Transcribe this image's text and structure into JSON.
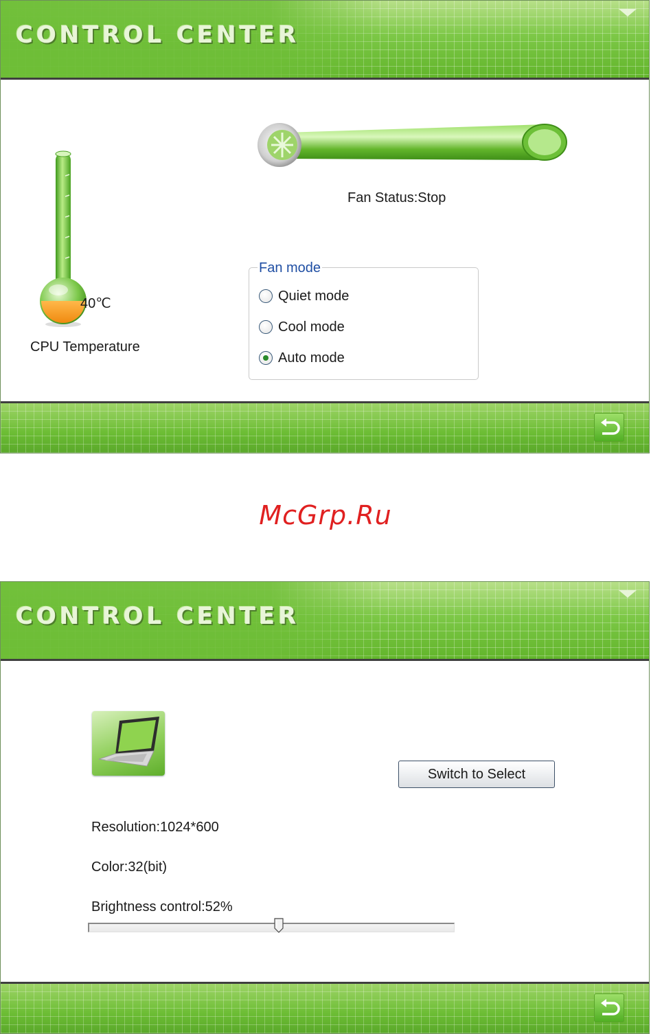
{
  "windows": [
    {
      "title": "CONTROL CENTER",
      "cpu": {
        "temperature_value": "40℃",
        "label": "CPU Temperature"
      },
      "fan": {
        "status": "Fan Status:Stop",
        "mode_legend": "Fan mode",
        "modes": [
          {
            "label": "Quiet mode",
            "selected": false
          },
          {
            "label": "Cool mode",
            "selected": false
          },
          {
            "label": "Auto mode",
            "selected": true
          }
        ]
      }
    },
    {
      "title": "CONTROL CENTER",
      "display": {
        "switch_button": "Switch to Select",
        "resolution": "Resolution:1024*600",
        "color": "Color:32(bit)",
        "brightness_label": "Brightness control:52%",
        "brightness_value": 52
      }
    }
  ],
  "watermark": "McGrp.Ru",
  "icons": {
    "menu": "dropdown-triangle-icon",
    "back": "back-arrow-icon",
    "fan": "fan-pipe-icon",
    "thermometer": "thermometer-icon",
    "laptop": "laptop-icon"
  },
  "colors": {
    "accent_green": "#6cbd34",
    "legend_blue": "#1f4ea3",
    "watermark_red": "#e02020"
  }
}
